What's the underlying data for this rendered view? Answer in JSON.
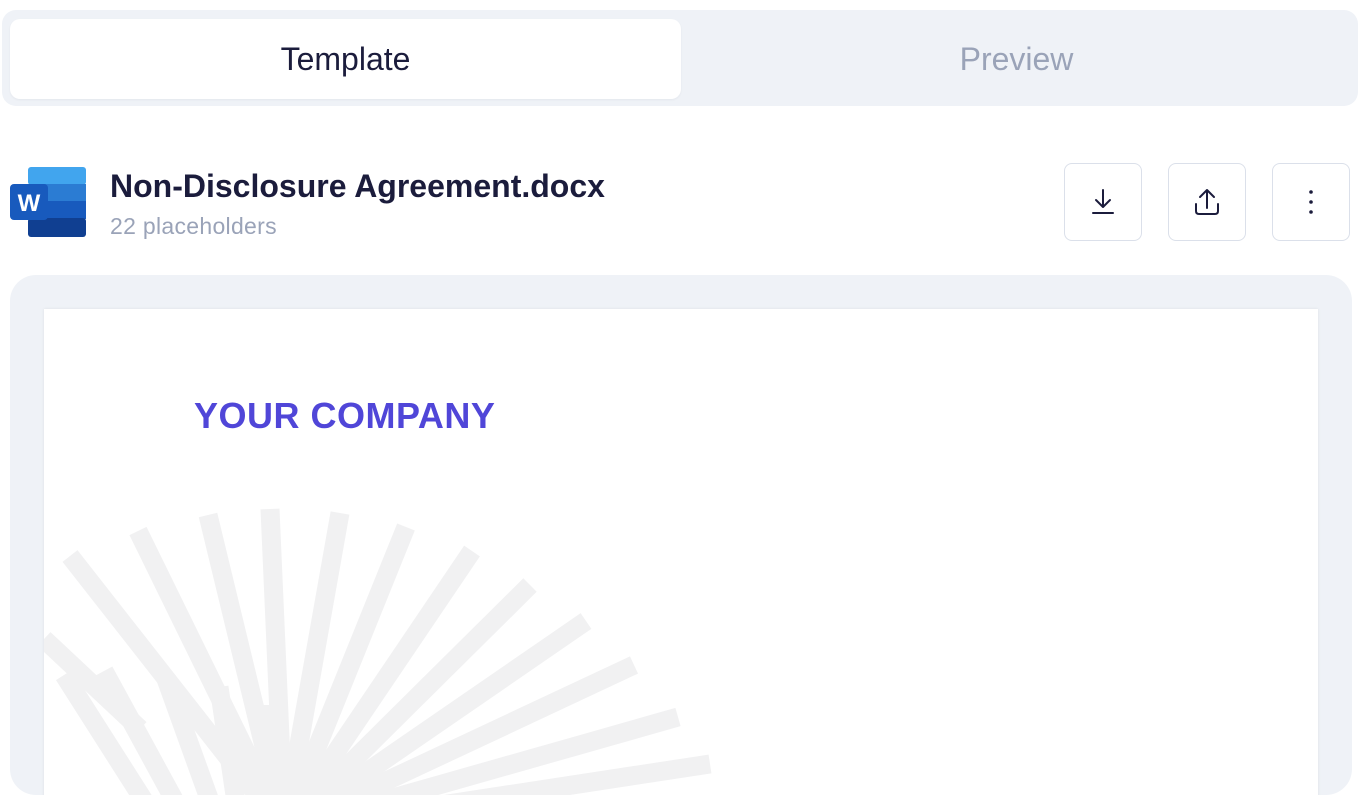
{
  "tabs": [
    {
      "label": "Template",
      "active": true
    },
    {
      "label": "Preview",
      "active": false
    }
  ],
  "file": {
    "name": "Non-Disclosure Agreement.docx",
    "placeholders": "22 placeholders",
    "icon": "word-icon",
    "icon_letter": "W"
  },
  "actions": [
    {
      "icon": "download-icon"
    },
    {
      "icon": "upload-icon"
    },
    {
      "icon": "more-vertical-icon"
    }
  ],
  "document": {
    "company_heading": "YOUR COMPANY",
    "decoration": "sunburst-graphic"
  },
  "colors": {
    "accent": "#5046d8",
    "title": "#1b1c3c",
    "muted": "#9aa3b8",
    "panel": "#eff2f7",
    "word_blue": "#2b5cc6"
  }
}
